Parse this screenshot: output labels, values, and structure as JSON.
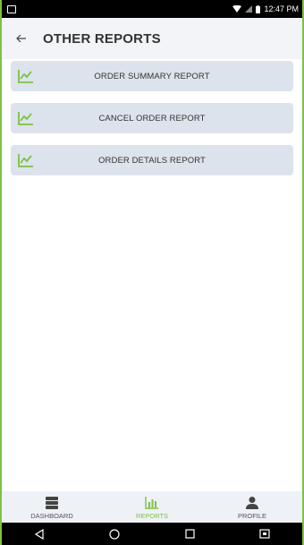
{
  "status_bar": {
    "time": "12:47 PM",
    "icons": [
      "notification-icon",
      "wifi-icon",
      "signal-icon",
      "battery-icon"
    ]
  },
  "app_bar": {
    "back_icon": "back-arrow-icon",
    "title": "OTHER REPORTS"
  },
  "reports": [
    {
      "label": "ORDER SUMMARY REPORT",
      "icon": "line-chart-icon"
    },
    {
      "label": "CANCEL ORDER REPORT",
      "icon": "line-chart-icon"
    },
    {
      "label": "ORDER DETAILS REPORT",
      "icon": "line-chart-icon"
    }
  ],
  "bottom_nav": {
    "items": [
      {
        "label": "DASHBOARD",
        "icon": "dashboard-icon",
        "active": false
      },
      {
        "label": "REPORTS",
        "icon": "bar-chart-icon",
        "active": true
      },
      {
        "label": "PROFILE",
        "icon": "person-icon",
        "active": false
      }
    ]
  },
  "system_nav": {
    "buttons": [
      "back-triangle-icon",
      "home-circle-icon",
      "recents-square-icon",
      "screenshot-icon"
    ]
  },
  "colors": {
    "accent": "#7cc242",
    "card_bg": "#dde3ec",
    "app_bar_bg": "#f2f4f7",
    "nav_bg": "#eef1f6"
  }
}
